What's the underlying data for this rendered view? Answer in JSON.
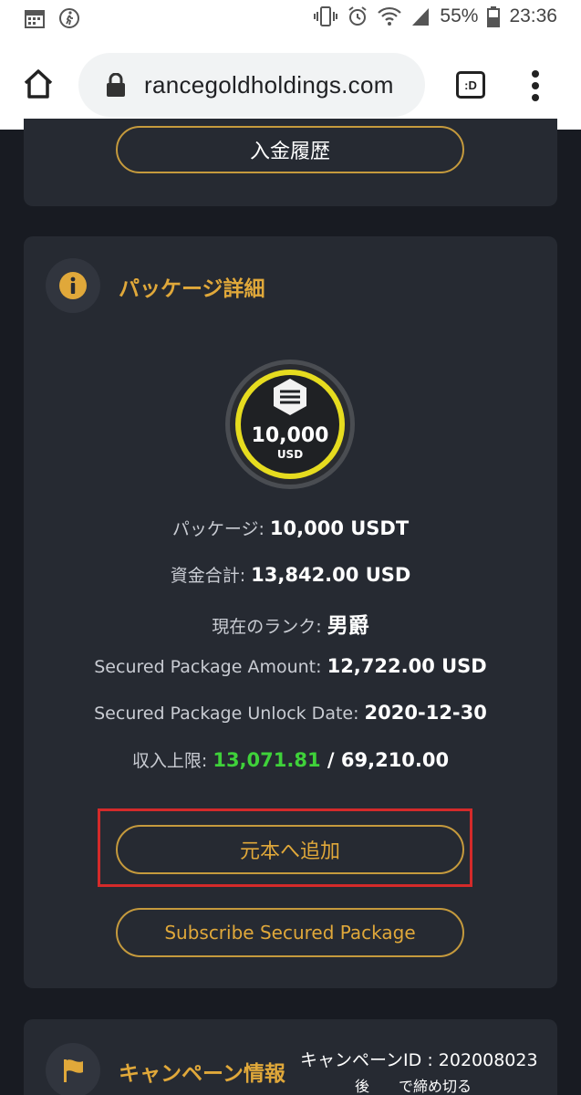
{
  "status_bar": {
    "battery": "55%",
    "time": "23:36"
  },
  "browser": {
    "url": "rancegoldholdings.com",
    "tabs_label": ":D"
  },
  "top_card": {
    "deposit_history_label": "入金履歴"
  },
  "package": {
    "section_title": "パッケージ詳細",
    "coin_amount": "10,000",
    "coin_unit": "USD",
    "rows": [
      {
        "label": "パッケージ: ",
        "value": "10,000 USDT"
      },
      {
        "label": "資金合計: ",
        "value": "13,842.00 USD"
      },
      {
        "label": "現在のランク: ",
        "value": "男爵"
      },
      {
        "label": "Secured Package Amount: ",
        "value": "12,722.00 USD"
      },
      {
        "label": "Secured Package Unlock Date: ",
        "value": "2020-12-30"
      }
    ],
    "income_limit": {
      "label": "収入上限: ",
      "current": "13,071.81",
      "separator": " / ",
      "max": "69,210.00"
    },
    "add_principal_label": "元本へ追加",
    "subscribe_label": "Subscribe Secured Package"
  },
  "campaign": {
    "section_title": "キャンペーン情報",
    "id_text": "キャンペーンID : 202008023",
    "deadline_text": "後　　で締め切る"
  },
  "colors": {
    "accent_gold": "#e0a83a",
    "button_border": "#c59a3d",
    "income_green": "#3fd13a",
    "highlight_red": "#d42a2a",
    "card_bg": "#262a32",
    "page_bg": "#181b22"
  },
  "icons": {
    "calendar": "calendar-icon",
    "walk": "walking-icon",
    "vibrate": "vibrate-icon",
    "alarm": "alarm-icon",
    "wifi": "wifi-icon",
    "signal": "signal-icon",
    "battery": "battery-icon",
    "home": "home-icon",
    "lock": "lock-icon",
    "menu": "more-vert-icon",
    "info": "info-icon",
    "flag": "flag-icon"
  }
}
